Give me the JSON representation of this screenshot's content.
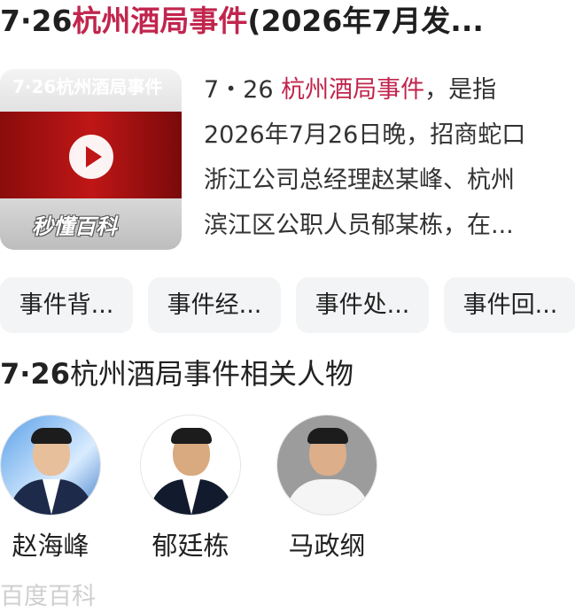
{
  "result": {
    "title_prefix": "7·26",
    "title_highlight": "杭州酒局事件",
    "title_suffix": "(2026年7月发...",
    "thumbnail": {
      "overlay_text": "7·26杭州酒局事件",
      "logo_text": "秒懂百科",
      "play_icon": "play-icon"
    },
    "summary": {
      "line1_prefix": "7・26 ",
      "line1_highlight": "杭州酒局事件",
      "line1_suffix": "，是指",
      "line2": "2026年7月26日晚，招商蛇口",
      "line3": "浙江公司总经理赵某峰、杭州",
      "line4": "滨江区公职人员郁某栋，在..."
    },
    "chips": [
      "事件背...",
      "事件经...",
      "事件处...",
      "事件回..."
    ],
    "people_section": {
      "title_num": "7·26",
      "title_text": "杭州酒局事件相关人物"
    },
    "people": [
      {
        "name": "赵海峰"
      },
      {
        "name": "郁廷栋"
      },
      {
        "name": "马政纲"
      }
    ],
    "source": "百度百科"
  },
  "colors": {
    "highlight": "#c1254d",
    "chip_bg": "#f3f4f6"
  }
}
